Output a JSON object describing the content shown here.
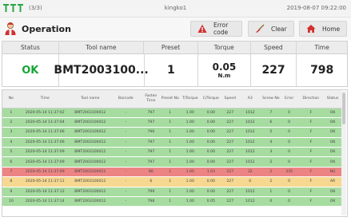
{
  "topbar": {
    "counter": "(3/3)",
    "device": "kingko1",
    "datetime": "2019-08-07 09:22:00"
  },
  "header": {
    "title": "Operation",
    "buttons": {
      "error_code": "Error code",
      "clear": "Clear",
      "home": "Home"
    }
  },
  "summary": {
    "headers": [
      "Status",
      "Tool name",
      "Preset",
      "Torque",
      "Speed",
      "Time"
    ],
    "status": "OK",
    "tool_name": "BMT2003100...",
    "preset": "1",
    "torque": "0.05",
    "torque_unit": "N.m",
    "speed": "227",
    "time": "798"
  },
  "history": {
    "columns": [
      "No",
      "Time",
      "Tool name",
      "Barcode",
      "Fasten Time",
      "Preset No",
      "T/Torque",
      "C/Torque",
      "Speed",
      "A3",
      "Screw No",
      "Error",
      "Direction",
      "Status"
    ],
    "rows": [
      [
        "1",
        "2020-05-14 11:37:02",
        "BMT2003100012",
        "-",
        "797",
        "1",
        "1.00",
        "0.00",
        "227",
        "1012",
        "7",
        "0",
        "F",
        "OK"
      ],
      [
        "2",
        "2020-05-14 11:37:04",
        "BMT2003100012",
        "-",
        "797",
        "1",
        "1.00",
        "0.00",
        "227",
        "1012",
        "6",
        "0",
        "F",
        "OK"
      ],
      [
        "3",
        "2020-05-14 11:37:06",
        "BMT2003100012",
        "-",
        "796",
        "1",
        "1.00",
        "0.00",
        "227",
        "1012",
        "5",
        "0",
        "F",
        "OK"
      ],
      [
        "4",
        "2020-05-14 11:37:06",
        "BMT2003100012",
        "-",
        "797",
        "1",
        "1.00",
        "0.00",
        "227",
        "1012",
        "4",
        "0",
        "F",
        "OK"
      ],
      [
        "5",
        "2020-05-14 11:37:09",
        "BMT2003100012",
        "-",
        "797",
        "1",
        "1.00",
        "0.00",
        "227",
        "1012",
        "3",
        "0",
        "F",
        "OK"
      ],
      [
        "6",
        "2020-05-14 11:37:09",
        "BMT2003100012",
        "-",
        "797",
        "1",
        "1.00",
        "0.00",
        "227",
        "1012",
        "2",
        "0",
        "F",
        "OK"
      ],
      [
        "7",
        "2020-05-14 11:37:09",
        "BMT2003100012",
        "-",
        "86",
        "1",
        "1.00",
        "1.03",
        "227",
        "32",
        "2",
        "335",
        "F",
        "NG"
      ],
      [
        "8",
        "2020-05-14 11:37:11",
        "BMT2003100012",
        "-",
        "6",
        "1",
        "1.00",
        "0.00",
        "227",
        "0",
        "2",
        "0",
        "F",
        "AR"
      ],
      [
        "9",
        "2020-05-14 11:37:12",
        "BMT2003100012",
        "-",
        "799",
        "1",
        "1.00",
        "0.00",
        "227",
        "1012",
        "1",
        "0",
        "F",
        "OK"
      ],
      [
        "10",
        "2020-05-14 11:37:14",
        "BMT2003100012",
        "-",
        "798",
        "1",
        "1.00",
        "0.05",
        "227",
        "1012",
        "0",
        "0",
        "F",
        "OK"
      ]
    ],
    "row_status_colors": {
      "OK": "#a6dca0",
      "NG": "#ec8484",
      "AR": "#f6d891"
    }
  },
  "colors": {
    "ok_text": "#16a535",
    "error_icon": "#d23030",
    "home_icon": "#d23030",
    "signal": "#28a745"
  },
  "icons": {
    "signal": "signal-bars-icon",
    "operator": "operator-icon",
    "error": "warning-icon",
    "clear": "broom-icon",
    "home": "home-icon"
  }
}
